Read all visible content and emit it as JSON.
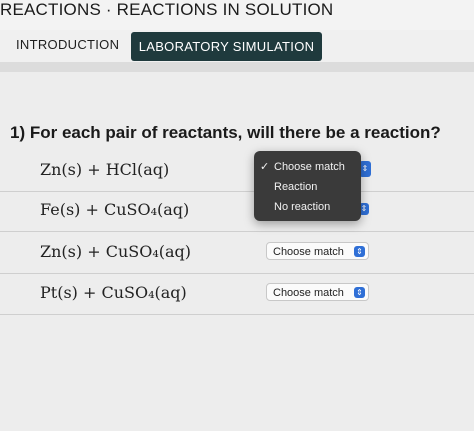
{
  "breadcrumb": "REACTIONS · REACTIONS IN SOLUTION",
  "tabs": [
    {
      "label": "INTRODUCTION",
      "active": false
    },
    {
      "label": "LABORATORY SIMULATION",
      "active": true
    }
  ],
  "question": "1) For each pair of reactants, will there be a reaction?",
  "rows": [
    {
      "equation": "Zn(s) + HCl(aq)",
      "selected": "Choose match"
    },
    {
      "equation": "Fe(s) + CuSO₄(aq)",
      "selected": "Choose match"
    },
    {
      "equation": "Zn(s) + CuSO₄(aq)",
      "selected": "Choose match"
    },
    {
      "equation": "Pt(s) + CuSO₄(aq)",
      "selected": "Choose match"
    }
  ],
  "dropdown": {
    "options": [
      {
        "label": "Choose match",
        "checked": true
      },
      {
        "label": "Reaction",
        "checked": false
      },
      {
        "label": "No reaction",
        "checked": false
      }
    ],
    "check_glyph": "✓"
  },
  "icons": {
    "caret": "updown-chevron-icon"
  },
  "colors": {
    "active_tab": "#1f3a3d",
    "select_accent": "#2f6fd6",
    "menu_bg": "#3a3a3a"
  }
}
